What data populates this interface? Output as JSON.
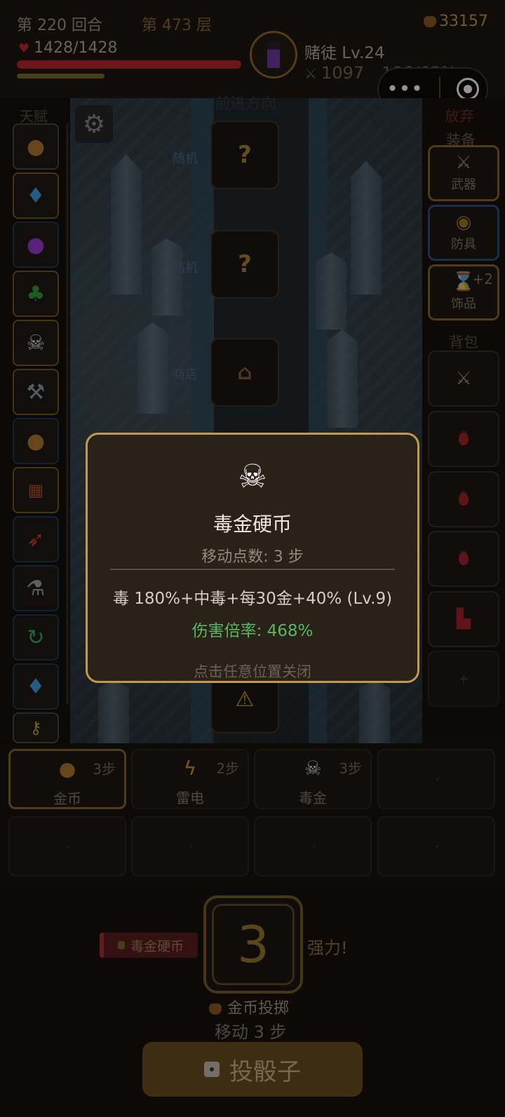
{
  "status": {
    "round": "第 220 回合",
    "floor": "第 473 层",
    "gold": "33157",
    "hp": "1428/1428",
    "hp_fraction": 1.0,
    "player_name": "赌徒 Lv.24",
    "attack": "1097",
    "crit": "186/65%"
  },
  "left": {
    "talent_label": "天赋",
    "talents": [
      "gold-sack-icon",
      "diamond-icon",
      "crystal-ball-icon",
      "clover-icon",
      "skull-icon",
      "dumbbell-icon",
      "coin-bag-icon",
      "grid-icon",
      "rocket-icon",
      "microscope-icon",
      "refresh-icon",
      "diamond-icon",
      "key-icon"
    ]
  },
  "map": {
    "title": "前进方向",
    "cells": [
      "?",
      "?"
    ],
    "tags": [
      "随机",
      "随机",
      "商店"
    ]
  },
  "right": {
    "abandon": "放弃",
    "equip_label": "装备",
    "weapon_label": "武器",
    "armor_label": "防具",
    "accessory_label": "饰品",
    "accessory_badge": "+2",
    "bag_label": "背包",
    "empty_slot": "+"
  },
  "skills": [
    {
      "name": "金币",
      "steps": "3步",
      "icon": "gold-bag-icon"
    },
    {
      "name": "雷电",
      "steps": "2步",
      "icon": "lightning-icon"
    },
    {
      "name": "毒金",
      "steps": "3步",
      "icon": "skull-icon"
    }
  ],
  "dice": {
    "talent_chip": "毒金硬币",
    "value": "3",
    "strong": "强力!",
    "coin_throw": "金币投掷",
    "move": "移动 3 步",
    "roll_button": "投骰子"
  },
  "modal": {
    "icon": "skull-crossbones-icon",
    "title": "毒金硬币",
    "subtitle": "移动点数: 3 步",
    "description": "毒 180%+中毒+每30金+40% (Lv.9)",
    "rate": "伤害倍率: 468%",
    "close_hint": "点击任意位置关闭"
  },
  "colors": {
    "accent_gold": "#c39a4d",
    "hp_red": "#b8262b",
    "rate_green": "#57b861"
  }
}
